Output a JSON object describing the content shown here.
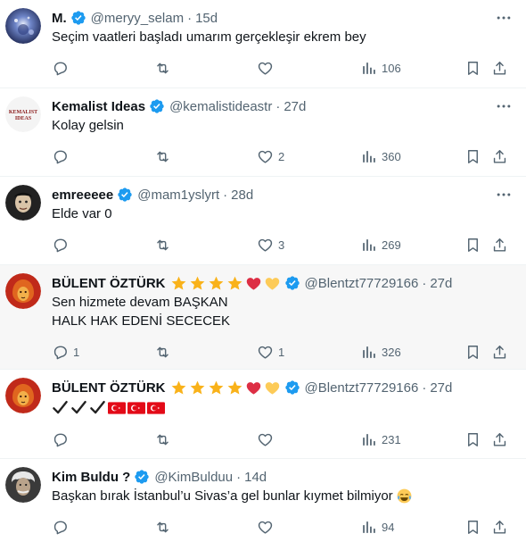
{
  "tweets": [
    {
      "name": "M.",
      "handle": "@meryy_selam",
      "sep": "·",
      "time": "15d",
      "text": [
        "Seçim vaatleri başladı umarım gerçekleşir ekrem bey"
      ],
      "replies": "",
      "retweets": "",
      "likes": "",
      "views": "106",
      "avatar": "galaxy",
      "emojis": []
    },
    {
      "name": "Kemalist Ideas",
      "handle": "@kemalistideastr",
      "sep": "·",
      "time": "27d",
      "text": [
        "Kolay gelsin"
      ],
      "replies": "",
      "retweets": "",
      "likes": "2",
      "views": "360",
      "avatar": "logo",
      "avatar_text": [
        "KEMALIST",
        "IDEAS"
      ],
      "emojis": []
    },
    {
      "name": "emreeeee",
      "handle": "@mam1yslyrt",
      "sep": "·",
      "time": "28d",
      "text": [
        "Elde var 0"
      ],
      "replies": "",
      "retweets": "",
      "likes": "3",
      "views": "269",
      "avatar": "dark",
      "emojis": []
    },
    {
      "name": "BÜLENT ÖZTÜRK",
      "handle": "@Blentzt77729166",
      "sep": "·",
      "time": "27d",
      "text": [
        "Sen hizmete devam BAŞKAN",
        "HALK HAK EDENİ SECECEK"
      ],
      "replies": "1",
      "retweets": "",
      "likes": "1",
      "views": "326",
      "avatar": "lion",
      "emojis": [
        "star",
        "star",
        "star",
        "star",
        "red-heart",
        "yellow-heart"
      ]
    },
    {
      "name": "BÜLENT ÖZTÜRK",
      "handle": "@Blentzt77729166",
      "sep": "·",
      "time": "27d",
      "text": [],
      "flagline": [
        "check",
        "check",
        "check",
        "flag-tr",
        "flag-tr",
        "flag-tr"
      ],
      "replies": "",
      "retweets": "",
      "likes": "",
      "views": "231",
      "avatar": "lion",
      "emojis": [
        "star",
        "star",
        "star",
        "star",
        "red-heart",
        "yellow-heart"
      ]
    },
    {
      "name": "Kim Buldu ?",
      "handle": "@KimBulduu",
      "sep": "·",
      "time": "14d",
      "text": [
        "Başkan bırak İstanbul’u Sivas’a gel bunlar kıymet bilmiyor"
      ],
      "text_emoji": "tears-of-joy",
      "replies": "",
      "retweets": "",
      "likes": "",
      "views": "94",
      "avatar": "einstein",
      "emojis": []
    }
  ],
  "colors": {
    "verified": "#1d9bf0",
    "muted": "#536471",
    "text": "#0f1419",
    "highlight_bg": "#f7f7f7",
    "divider": "#eff3f4"
  }
}
